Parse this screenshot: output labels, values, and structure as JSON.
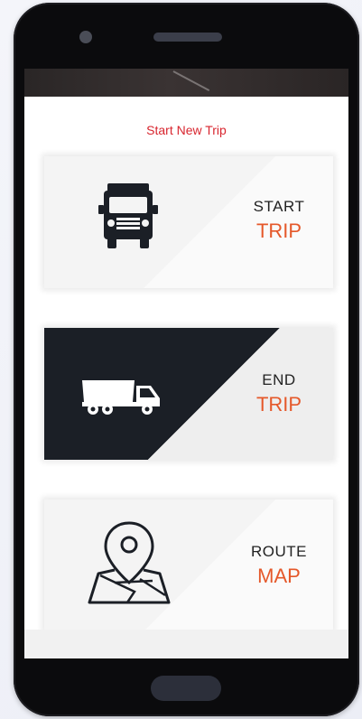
{
  "screen": {
    "title": "Start New Trip"
  },
  "cards": [
    {
      "top_label": "START",
      "bottom_label": "TRIP",
      "icon": "truck-front-icon"
    },
    {
      "top_label": "END",
      "bottom_label": "TRIP",
      "icon": "dump-truck-icon"
    },
    {
      "top_label": "ROUTE",
      "bottom_label": "MAP",
      "icon": "map-pin-icon"
    }
  ],
  "colors": {
    "accent_red": "#d8262f",
    "accent_orange": "#e5582a",
    "dark_panel": "#1b1f26",
    "phone_body": "#0b0b0d"
  }
}
